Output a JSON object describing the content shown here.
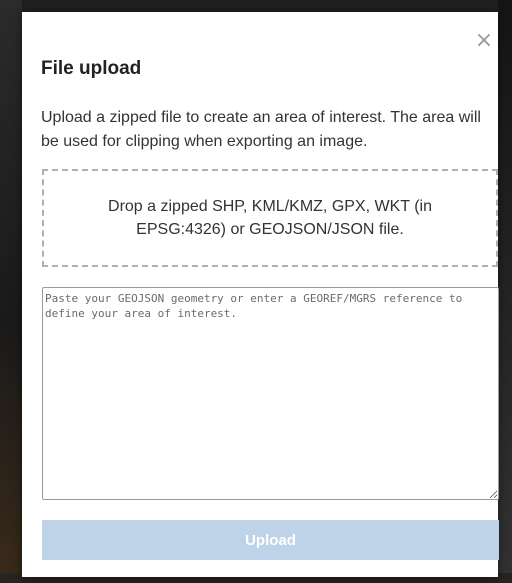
{
  "dialog": {
    "title": "File upload",
    "close_icon": "×",
    "description": "Upload a zipped file to create an area of interest. The area will be used for clipping when exporting an image.",
    "dropzone_text": "Drop a zipped SHP, KML/KMZ, GPX, WKT (in EPSG:4326) or GEOJSON/JSON file.",
    "geometry_input": {
      "value": "",
      "placeholder": "Paste your GEOJSON geometry or enter a GEOREF/MGRS reference to define your area of interest."
    },
    "upload_button": {
      "label": "Upload",
      "state": "disabled"
    }
  },
  "colors": {
    "upload_button_bg": "#bed3e8",
    "dropzone_border": "#b0b0b0",
    "title_text": "#222222"
  },
  "icons": {
    "close": "close-icon",
    "textarea_resize": "resize-grip-icon"
  }
}
